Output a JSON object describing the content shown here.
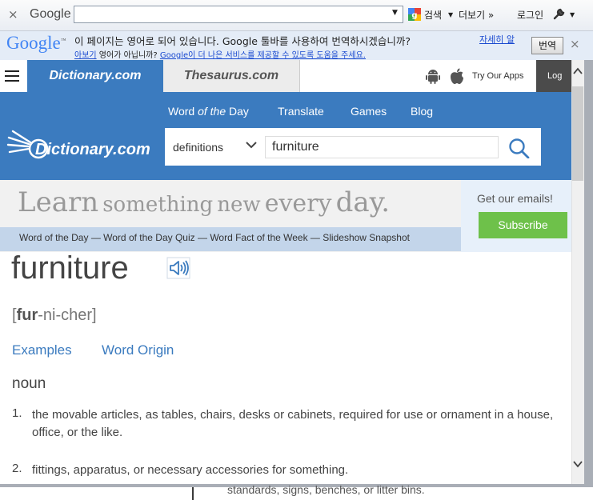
{
  "google_toolbar": {
    "close_glyph": "×",
    "logo_text": "Google",
    "search_value": "",
    "search_label": "검색",
    "more_label": "더보기 »",
    "login_label": "로그인"
  },
  "translate_bar": {
    "logo_text": "Google",
    "message": "이 페이지는 영어로 되어 있습니다. Google 툴바를 사용하여 번역하시겠습니까?",
    "details_link": "자세히 알",
    "details_link_cont": "아보기",
    "not_english": "영어가 아닙니까?",
    "help_link": "Google이 더 나은 서비스를 제공할 수 있도록 도움을 주세요.",
    "translate_button": "번역",
    "close_glyph": "×"
  },
  "site_header": {
    "tabs": [
      {
        "label": "Dictionary.com"
      },
      {
        "label": "Thesaurus.com"
      }
    ],
    "try_apps": "Try Our Apps",
    "login": "Log In",
    "nav": [
      {
        "label_pre": "Word ",
        "label_em": "of the",
        "label_post": " Day"
      },
      {
        "label": "Translate"
      },
      {
        "label": "Games"
      },
      {
        "label": "Blog"
      }
    ],
    "logo_text": "Dictionary.com",
    "search_type": "definitions",
    "search_value": "furniture"
  },
  "banner": {
    "learn": "Learn",
    "something": "something",
    "new": "new",
    "every": "every",
    "day": "day.",
    "links": "Word of the Day — Word of the Day Quiz — Word Fact of the Week — Slideshow Snapshot",
    "email_title": "Get our emails!",
    "subscribe": "Subscribe"
  },
  "entry": {
    "headword": "furniture",
    "pron_open": "[",
    "pron_stress": "fur",
    "pron_rest": "-ni-cher",
    "pron_close": "]",
    "examples_link": "Examples",
    "origin_link": "Word Origin",
    "part_of_speech": "noun",
    "definitions": [
      {
        "num": "1.",
        "text": "the movable articles, as tables, chairs, desks or cabinets, required for use or ornament in a house, office, or the like."
      },
      {
        "num": "2.",
        "text": "fittings, apparatus, or necessary accessories for something."
      }
    ]
  },
  "background_page": {
    "text": "standards, signs, benches, or litter bins."
  },
  "colors": {
    "brand_blue": "#3b7bbf",
    "subscribe_green": "#6ec14a",
    "link_blue": "#3b7bbf"
  }
}
